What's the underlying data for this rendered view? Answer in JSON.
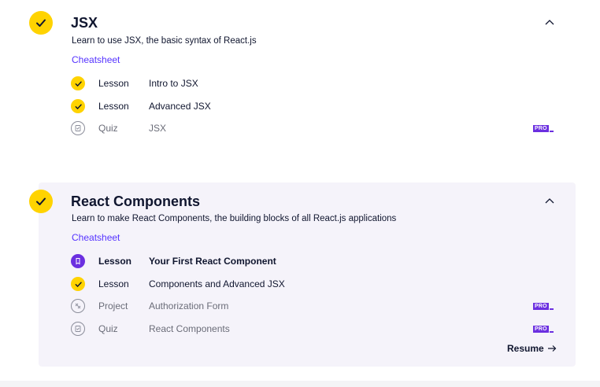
{
  "modules": [
    {
      "title": "JSX",
      "description": "Learn to use JSX, the basic syntax of React.js",
      "cheatsheet_label": "Cheatsheet",
      "status_icon": "check-icon",
      "items": [
        {
          "type": "Lesson",
          "name": "Intro to JSX",
          "status": "complete",
          "icon": "check-icon"
        },
        {
          "type": "Lesson",
          "name": "Advanced JSX",
          "status": "complete",
          "icon": "check-icon"
        },
        {
          "type": "Quiz",
          "name": "JSX",
          "status": "locked",
          "icon": "quiz-icon",
          "pro_badge": "PRO"
        }
      ]
    },
    {
      "title": "React Components",
      "description": "Learn to make React Components, the building blocks of all React.js applications",
      "cheatsheet_label": "Cheatsheet",
      "status_icon": "check-icon",
      "items": [
        {
          "type": "Lesson",
          "name": "Your First React Component",
          "status": "current",
          "icon": "lesson-doc-icon"
        },
        {
          "type": "Lesson",
          "name": "Components and Advanced JSX",
          "status": "complete",
          "icon": "check-icon"
        },
        {
          "type": "Project",
          "name": "Authorization Form",
          "status": "locked",
          "icon": "project-icon",
          "pro_badge": "PRO"
        },
        {
          "type": "Quiz",
          "name": "React Components",
          "status": "locked",
          "icon": "quiz-icon",
          "pro_badge": "PRO"
        }
      ],
      "resume_label": "Resume"
    }
  ],
  "colors": {
    "accent_yellow": "#ffd300",
    "brand_purple": "#6b2fe0",
    "link_blue": "#5533ff",
    "panel_bg": "#f5f3fa"
  }
}
